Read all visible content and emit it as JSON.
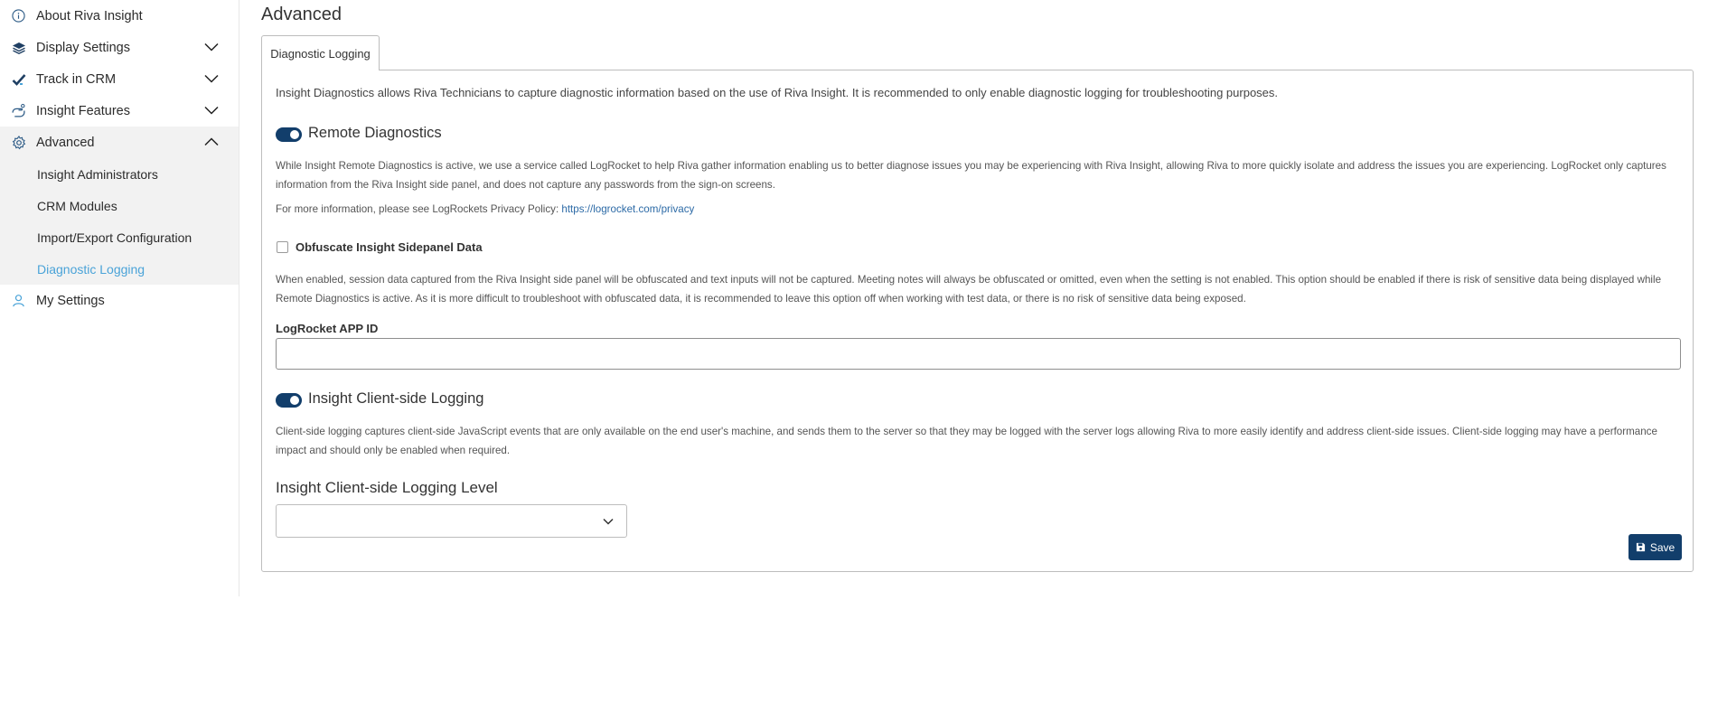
{
  "sidebar": {
    "items": [
      {
        "label": "About Riva Insight",
        "icon": "info-icon"
      },
      {
        "label": "Display Settings",
        "icon": "layers-icon",
        "expandable": true
      },
      {
        "label": "Track in CRM",
        "icon": "check-icon",
        "expandable": true
      },
      {
        "label": "Insight Features",
        "icon": "hand-icon",
        "expandable": true
      },
      {
        "label": "Advanced",
        "icon": "gear-icon",
        "expandable": true,
        "expanded": true
      },
      {
        "label": "My Settings",
        "icon": "user-icon"
      }
    ],
    "submenu": [
      {
        "label": "Insight Administrators"
      },
      {
        "label": "CRM Modules"
      },
      {
        "label": "Import/Export Configuration"
      },
      {
        "label": "Diagnostic Logging",
        "selected": true
      }
    ]
  },
  "main": {
    "title": "Advanced",
    "tab_label": "Diagnostic Logging",
    "intro": "Insight Diagnostics allows Riva Technicians to capture diagnostic information based on the use of Riva Insight. It is recommended to only enable diagnostic logging for troubleshooting purposes.",
    "remote": {
      "title": "Remote Diagnostics",
      "enabled": true,
      "description": "While Insight Remote Diagnostics is active, we use a service called LogRocket to help Riva gather information enabling us to better diagnose issues you may be experiencing with Riva Insight, allowing Riva to more quickly isolate and address the issues you are experiencing. LogRocket only captures information from the Riva Insight side panel, and does not capture any passwords from the sign-on screens.",
      "privacy_prefix": "For more information, please see LogRockets Privacy Policy: ",
      "privacy_link": "https://logrocket.com/privacy"
    },
    "obfuscate": {
      "label": "Obfuscate Insight Sidepanel Data",
      "checked": false,
      "description": "When enabled, session data captured from the Riva Insight side panel will be obfuscated and text inputs will not be captured. Meeting notes will always be obfuscated or omitted, even when the setting is not enabled. This option should be enabled if there is risk of sensitive data being displayed while Remote Diagnostics is active. As it is more difficult to troubleshoot with obfuscated data, it is recommended to leave this option off when working with test data, or there is no risk of sensitive data being exposed."
    },
    "app_id": {
      "label": "LogRocket APP ID",
      "value": ""
    },
    "client_logging": {
      "title": "Insight Client-side Logging",
      "enabled": true,
      "description": "Client-side logging captures client-side JavaScript events that are only available on the end user's machine, and sends them to the server so that they may be logged with the server logs allowing Riva to more easily identify and address client-side issues. Client-side logging may have a performance impact and should only be enabled when required."
    },
    "logging_level": {
      "label": "Insight Client-side Logging Level",
      "selected": ""
    },
    "save_label": "Save"
  },
  "colors": {
    "accent": "#123e6b",
    "selected_nav": "#4aa3d8",
    "link": "#2c6aa6"
  }
}
